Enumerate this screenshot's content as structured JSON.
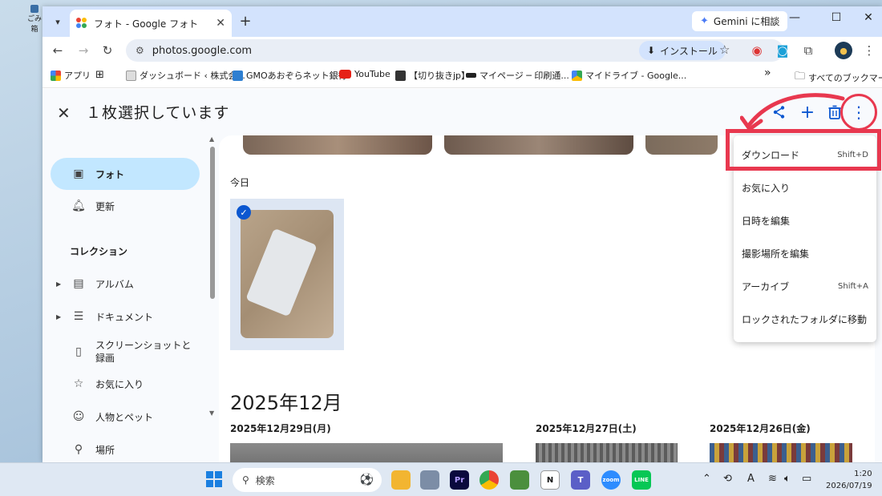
{
  "desktop": {
    "icon_label": "ごみ箱"
  },
  "browser": {
    "tab": {
      "title": "フォト - Google フォト",
      "close": "✕"
    },
    "new_tab": "+",
    "gemini_label": "Gemini に相談",
    "window_controls": {
      "minimize": "—",
      "maximize": "☐",
      "close": "✕"
    },
    "nav": {
      "back": "←",
      "forward": "→",
      "reload": "↻"
    },
    "url": "photos.google.com",
    "install_label": "インストール",
    "bookmarks": [
      {
        "label": "アプリ"
      },
      {
        "label": "ダッシュボード ‹ 株式会..."
      },
      {
        "label": "GMOあおぞらネット銀行"
      },
      {
        "label": "YouTube"
      },
      {
        "label": "【切り抜きjp】"
      },
      {
        "label": "マイページ ─ 印刷通..."
      },
      {
        "label": "マイドライブ - Google..."
      }
    ],
    "bookmarks_more": "»",
    "all_bookmarks": "すべてのブックマーク"
  },
  "photos": {
    "selection_title": "１枚選択しています",
    "sidebar": {
      "items": [
        {
          "label": "フォト",
          "icon": "photo-icon"
        },
        {
          "label": "更新",
          "icon": "bell-icon"
        }
      ],
      "collections_heading": "コレクション",
      "collections": [
        {
          "label": "アルバム",
          "icon": "album-icon"
        },
        {
          "label": "ドキュメント",
          "icon": "document-icon"
        },
        {
          "label": "スクリーンショットと録画",
          "icon": "phone-icon"
        },
        {
          "label": "お気に入り",
          "icon": "star-icon"
        },
        {
          "label": "人物とペット",
          "icon": "face-icon"
        },
        {
          "label": "場所",
          "icon": "pin-icon"
        }
      ]
    },
    "today_label": "今日",
    "month_label": "2025年12月",
    "dates": [
      "2025年12月29日(月)",
      "2025年12月27日(土)",
      "2025年12月26日(金)"
    ],
    "menu": [
      {
        "label": "ダウンロード",
        "shortcut": "Shift+D"
      },
      {
        "label": "お気に入り",
        "shortcut": ""
      },
      {
        "label": "日時を編集",
        "shortcut": ""
      },
      {
        "label": "撮影場所を編集",
        "shortcut": ""
      },
      {
        "label": "アーカイブ",
        "shortcut": "Shift+A"
      },
      {
        "label": "ロックされたフォルダに移動",
        "shortcut": ""
      }
    ]
  },
  "taskbar": {
    "search_label": "検索",
    "time": "1:20",
    "date": "2026/07/19"
  },
  "colors": {
    "accent": "#0b57d0",
    "highlight": "#e8384f",
    "nav_active": "#c2e7ff"
  }
}
